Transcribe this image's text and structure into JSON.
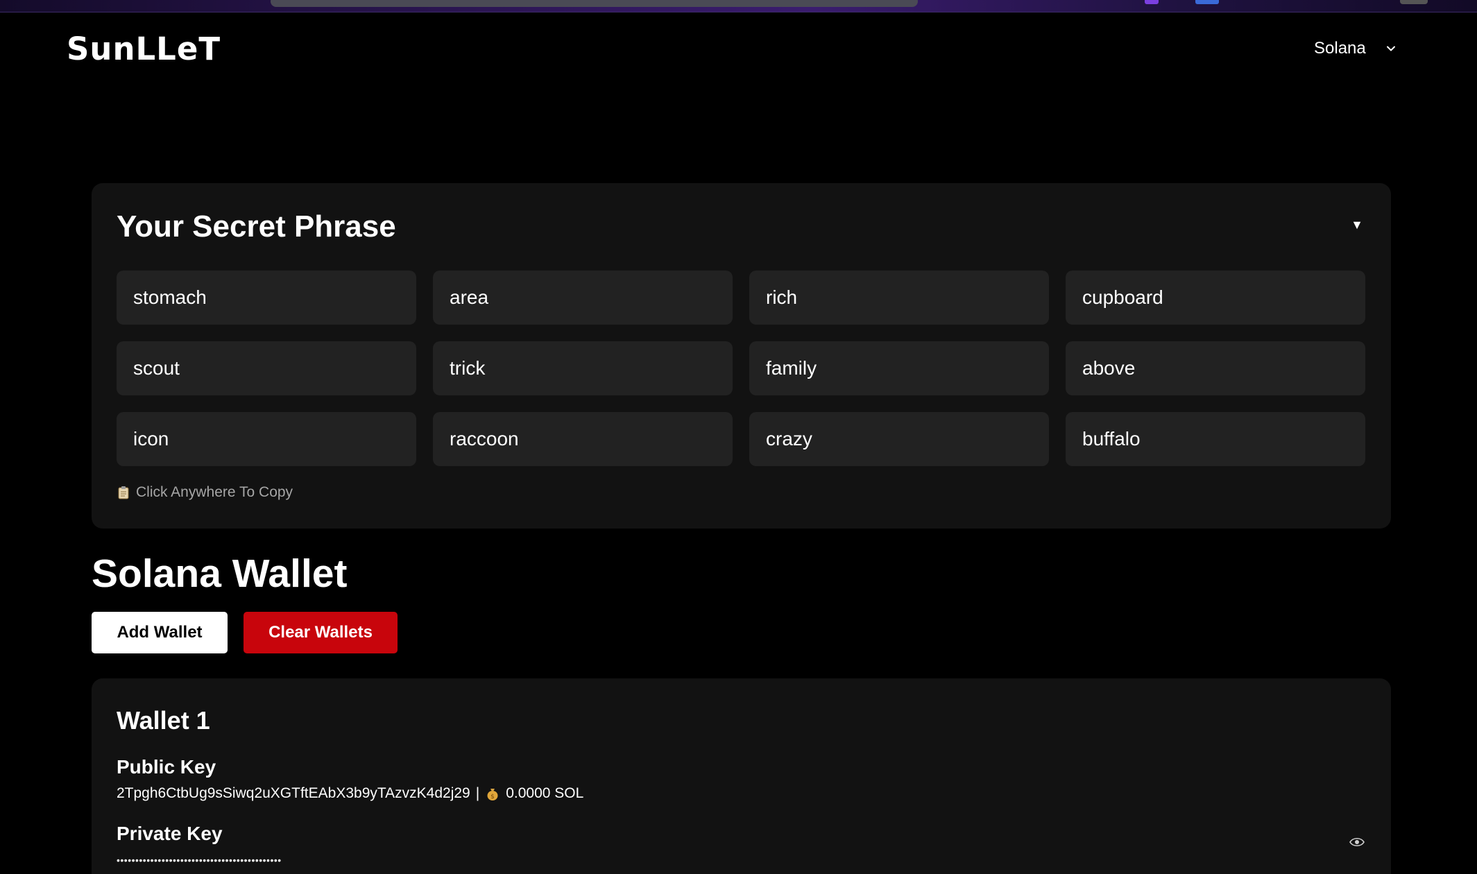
{
  "app": {
    "brand": "SunLLeT"
  },
  "header": {
    "network_selected": "Solana",
    "network_icon": "chevron-down-icon"
  },
  "secret_phrase": {
    "title": "Your Secret Phrase",
    "toggle_glyph": "▼",
    "words": [
      "stomach",
      "area",
      "rich",
      "cupboard",
      "scout",
      "trick",
      "family",
      "above",
      "icon",
      "raccoon",
      "crazy",
      "buffalo"
    ],
    "copy_hint": "Click Anywhere To Copy",
    "copy_icon": "clipboard-icon"
  },
  "wallet_section": {
    "heading": "Solana Wallet",
    "add_label": "Add Wallet",
    "clear_label": "Clear Wallets",
    "colors": {
      "clear_button": "#c8050c",
      "card_background": "#121212",
      "word_background": "#222222"
    }
  },
  "wallets": [
    {
      "title": "Wallet 1",
      "public_key_label": "Public Key",
      "public_key": "2Tpgh6CtbUg9sSiwq2uXGTftEAbX3b9yTAzvzK4d2j29",
      "separator": "|",
      "balance_icon": "moneybag-icon",
      "balance": "0.0000 SOL",
      "private_key_label": "Private Key",
      "private_key_masked": "••••••••••••••••••••••••••••••••••••••••••••",
      "reveal_icon": "eye-icon"
    }
  ]
}
